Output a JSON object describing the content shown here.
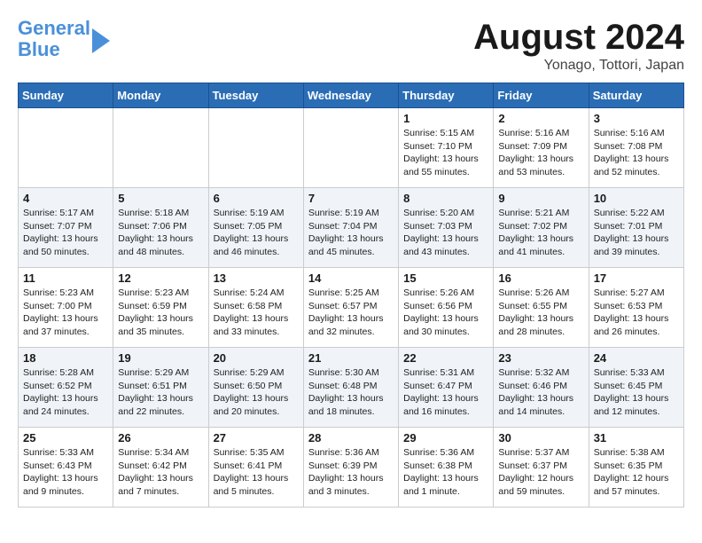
{
  "logo": {
    "line1": "General",
    "line2": "Blue"
  },
  "title": "August 2024",
  "subtitle": "Yonago, Tottori, Japan",
  "days_of_week": [
    "Sunday",
    "Monday",
    "Tuesday",
    "Wednesday",
    "Thursday",
    "Friday",
    "Saturday"
  ],
  "weeks": [
    [
      {
        "day": "",
        "info": ""
      },
      {
        "day": "",
        "info": ""
      },
      {
        "day": "",
        "info": ""
      },
      {
        "day": "",
        "info": ""
      },
      {
        "day": "1",
        "info": "Sunrise: 5:15 AM\nSunset: 7:10 PM\nDaylight: 13 hours\nand 55 minutes."
      },
      {
        "day": "2",
        "info": "Sunrise: 5:16 AM\nSunset: 7:09 PM\nDaylight: 13 hours\nand 53 minutes."
      },
      {
        "day": "3",
        "info": "Sunrise: 5:16 AM\nSunset: 7:08 PM\nDaylight: 13 hours\nand 52 minutes."
      }
    ],
    [
      {
        "day": "4",
        "info": "Sunrise: 5:17 AM\nSunset: 7:07 PM\nDaylight: 13 hours\nand 50 minutes."
      },
      {
        "day": "5",
        "info": "Sunrise: 5:18 AM\nSunset: 7:06 PM\nDaylight: 13 hours\nand 48 minutes."
      },
      {
        "day": "6",
        "info": "Sunrise: 5:19 AM\nSunset: 7:05 PM\nDaylight: 13 hours\nand 46 minutes."
      },
      {
        "day": "7",
        "info": "Sunrise: 5:19 AM\nSunset: 7:04 PM\nDaylight: 13 hours\nand 45 minutes."
      },
      {
        "day": "8",
        "info": "Sunrise: 5:20 AM\nSunset: 7:03 PM\nDaylight: 13 hours\nand 43 minutes."
      },
      {
        "day": "9",
        "info": "Sunrise: 5:21 AM\nSunset: 7:02 PM\nDaylight: 13 hours\nand 41 minutes."
      },
      {
        "day": "10",
        "info": "Sunrise: 5:22 AM\nSunset: 7:01 PM\nDaylight: 13 hours\nand 39 minutes."
      }
    ],
    [
      {
        "day": "11",
        "info": "Sunrise: 5:23 AM\nSunset: 7:00 PM\nDaylight: 13 hours\nand 37 minutes."
      },
      {
        "day": "12",
        "info": "Sunrise: 5:23 AM\nSunset: 6:59 PM\nDaylight: 13 hours\nand 35 minutes."
      },
      {
        "day": "13",
        "info": "Sunrise: 5:24 AM\nSunset: 6:58 PM\nDaylight: 13 hours\nand 33 minutes."
      },
      {
        "day": "14",
        "info": "Sunrise: 5:25 AM\nSunset: 6:57 PM\nDaylight: 13 hours\nand 32 minutes."
      },
      {
        "day": "15",
        "info": "Sunrise: 5:26 AM\nSunset: 6:56 PM\nDaylight: 13 hours\nand 30 minutes."
      },
      {
        "day": "16",
        "info": "Sunrise: 5:26 AM\nSunset: 6:55 PM\nDaylight: 13 hours\nand 28 minutes."
      },
      {
        "day": "17",
        "info": "Sunrise: 5:27 AM\nSunset: 6:53 PM\nDaylight: 13 hours\nand 26 minutes."
      }
    ],
    [
      {
        "day": "18",
        "info": "Sunrise: 5:28 AM\nSunset: 6:52 PM\nDaylight: 13 hours\nand 24 minutes."
      },
      {
        "day": "19",
        "info": "Sunrise: 5:29 AM\nSunset: 6:51 PM\nDaylight: 13 hours\nand 22 minutes."
      },
      {
        "day": "20",
        "info": "Sunrise: 5:29 AM\nSunset: 6:50 PM\nDaylight: 13 hours\nand 20 minutes."
      },
      {
        "day": "21",
        "info": "Sunrise: 5:30 AM\nSunset: 6:48 PM\nDaylight: 13 hours\nand 18 minutes."
      },
      {
        "day": "22",
        "info": "Sunrise: 5:31 AM\nSunset: 6:47 PM\nDaylight: 13 hours\nand 16 minutes."
      },
      {
        "day": "23",
        "info": "Sunrise: 5:32 AM\nSunset: 6:46 PM\nDaylight: 13 hours\nand 14 minutes."
      },
      {
        "day": "24",
        "info": "Sunrise: 5:33 AM\nSunset: 6:45 PM\nDaylight: 13 hours\nand 12 minutes."
      }
    ],
    [
      {
        "day": "25",
        "info": "Sunrise: 5:33 AM\nSunset: 6:43 PM\nDaylight: 13 hours\nand 9 minutes."
      },
      {
        "day": "26",
        "info": "Sunrise: 5:34 AM\nSunset: 6:42 PM\nDaylight: 13 hours\nand 7 minutes."
      },
      {
        "day": "27",
        "info": "Sunrise: 5:35 AM\nSunset: 6:41 PM\nDaylight: 13 hours\nand 5 minutes."
      },
      {
        "day": "28",
        "info": "Sunrise: 5:36 AM\nSunset: 6:39 PM\nDaylight: 13 hours\nand 3 minutes."
      },
      {
        "day": "29",
        "info": "Sunrise: 5:36 AM\nSunset: 6:38 PM\nDaylight: 13 hours\nand 1 minute."
      },
      {
        "day": "30",
        "info": "Sunrise: 5:37 AM\nSunset: 6:37 PM\nDaylight: 12 hours\nand 59 minutes."
      },
      {
        "day": "31",
        "info": "Sunrise: 5:38 AM\nSunset: 6:35 PM\nDaylight: 12 hours\nand 57 minutes."
      }
    ]
  ]
}
